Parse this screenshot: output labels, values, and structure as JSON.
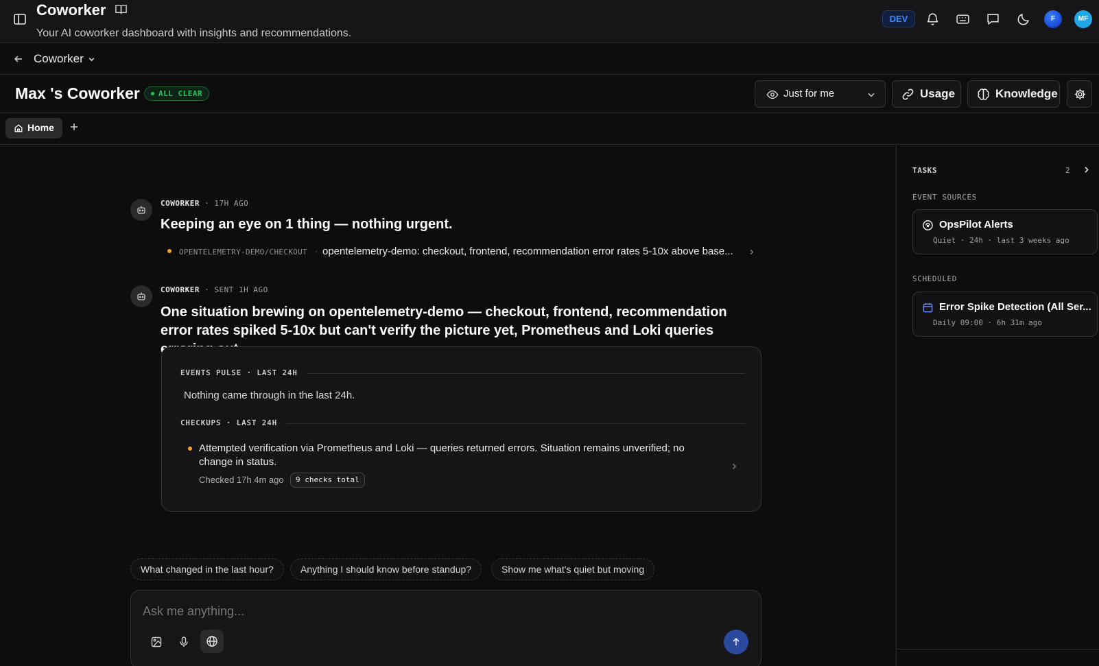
{
  "app": {
    "title": "Coworker",
    "subtitle": "Your AI coworker dashboard with insights and recommendations.",
    "env_badge": "DEV",
    "avatar_initial": "F",
    "user_initials": "MF"
  },
  "breadcrumb": {
    "label": "Coworker"
  },
  "header": {
    "title": "Max 's Coworker",
    "status": "ALL CLEAR",
    "visibility": "Just for me",
    "usage_label": "Usage",
    "knowledge_label": "Knowledge"
  },
  "tabs": [
    {
      "label": "Home"
    }
  ],
  "feed": {
    "messages": [
      {
        "author": "COWORKER",
        "time": "17H AGO",
        "headline": "Keeping an eye on 1 thing — nothing urgent.",
        "watch": {
          "source": "OPENTELEMETRY-DEMO/CHECKOUT",
          "text": "opentelemetry-demo: checkout, frontend, recommendation error rates 5-10x above base..."
        }
      },
      {
        "author": "COWORKER",
        "time": "SENT 1H AGO",
        "headline": "One situation brewing on opentelemetry-demo — checkout, frontend, recommendation error rates spiked 5-10x but can't verify the picture yet, Prometheus and Loki queries erroring out."
      }
    ],
    "summary": {
      "events_title": "EVENTS PULSE · LAST 24H",
      "events_text": "Nothing came through in the last 24h.",
      "checkups_title": "CHECKUPS · LAST 24H",
      "checkup_text": "Attempted verification via Prometheus and Loki — queries returned errors. Situation remains unverified; no change in status.",
      "checkup_meta": "Checked 17h 4m ago",
      "checkup_badge": "9 checks total"
    }
  },
  "suggestions": [
    "What changed in the last hour?",
    "Anything I should know before standup?",
    "Show me what's quiet but moving"
  ],
  "composer": {
    "placeholder": "Ask me anything..."
  },
  "right_panel": {
    "tasks_label": "TASKS",
    "tasks_count": "2",
    "event_sources_label": "EVENT SOURCES",
    "event_source": {
      "title": "OpsPilot Alerts",
      "subtitle": "Quiet · 24h · last 3 weeks ago"
    },
    "scheduled_label": "SCHEDULED",
    "scheduled": {
      "title": "Error Spike Detection (All Ser...",
      "subtitle": "Daily 09:00 · 6h 31m ago"
    }
  },
  "colors": {
    "accent_blue": "#3d8bff",
    "status_green": "#22c55e",
    "warning_amber": "#f5a524",
    "send_button": "#2b4a9e"
  },
  "icons": [
    "sidebar-toggle-icon",
    "book-icon",
    "bell-icon",
    "keyboard-icon",
    "chat-icon",
    "moon-icon",
    "back-arrow-icon",
    "chevron-down-icon",
    "eye-icon",
    "link-icon",
    "brain-icon",
    "gear-icon",
    "home-icon",
    "plus-icon",
    "bot-icon",
    "chevron-right-icon",
    "image-icon",
    "mic-icon",
    "globe-icon",
    "arrow-up-icon",
    "radio-icon",
    "calendar-icon"
  ]
}
